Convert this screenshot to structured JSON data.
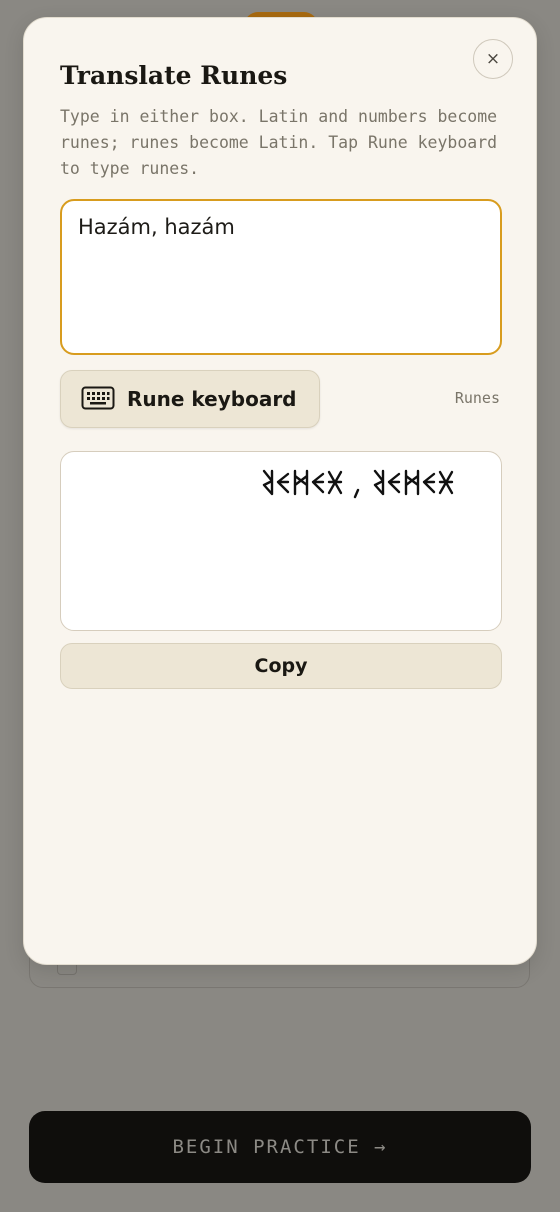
{
  "modal": {
    "title": "Translate Runes",
    "description": "Type in either box. Latin and numbers become runes; runes become Latin. Tap Rune keyboard to type runes.",
    "close_symbol": "×",
    "latin_value": "Hazám, hazám",
    "keyboard_button_label": "Rune keyboard",
    "keyboard_icon": "keyboard-icon",
    "runes_label": "Runes",
    "runes_output_text": "Hazám, hazám rendered in Old Hungarian runes (right-to-left)",
    "copy_label": "Copy"
  },
  "background": {
    "begin_label": "BEGIN PRACTICE →"
  },
  "colors": {
    "accent": "#d89c1e",
    "modal_bg": "#f9f5ee",
    "button_bg": "#ede6d5",
    "overlay": "#8a8883",
    "primary_dark": "#0f0e0c"
  }
}
